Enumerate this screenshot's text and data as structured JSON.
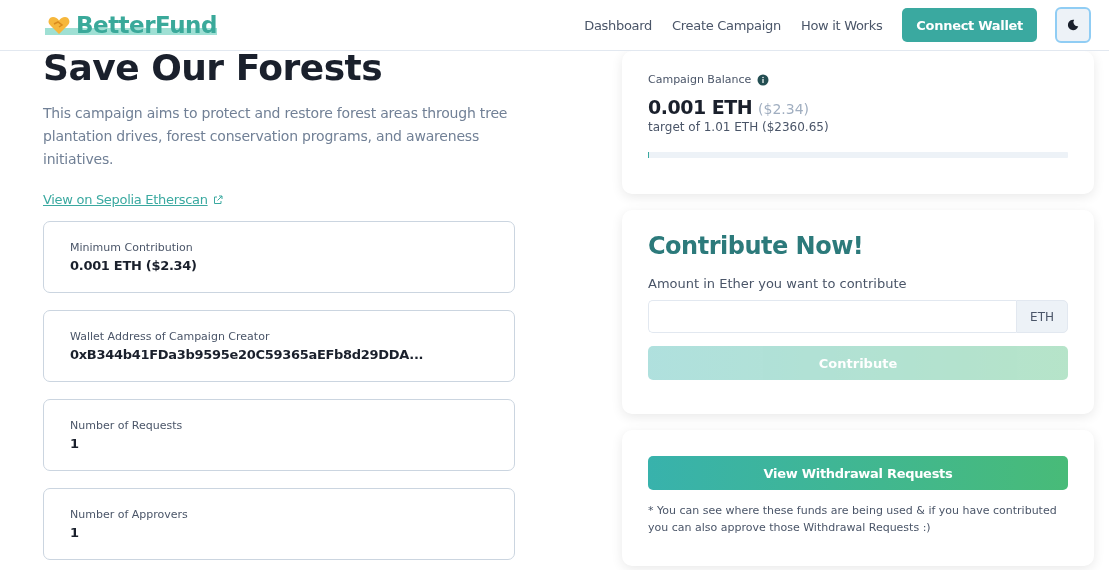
{
  "header": {
    "brand": "BetterFund",
    "nav": [
      "Dashboard",
      "Create Campaign",
      "How it Works"
    ],
    "connect_button": "Connect Wallet",
    "theme_toggle": {
      "dark": false
    }
  },
  "campaign": {
    "title": "Save Our Forests",
    "description": "This campaign aims to protect and restore forest areas through tree plantation drives, forest conservation programs, and awareness initiatives.",
    "etherscan_link": "View on Sepolia Etherscan",
    "stats": [
      {
        "label": "Minimum Contribution",
        "value": "0.001 ETH ($2.34)"
      },
      {
        "label": "Wallet Address of Campaign Creator",
        "value": "0xB344b41FDa3b9595e20C59365aEFb8d29DDA..."
      },
      {
        "label": "Number of Requests",
        "value": "1"
      },
      {
        "label": "Number of Approvers",
        "value": "1"
      }
    ]
  },
  "balance": {
    "label": "Campaign Balance",
    "amount": "0.001 ETH",
    "amount_usd": "($2.34)",
    "target": "target of 1.01 ETH ($2360.65)",
    "level": 0.002
  },
  "contribute": {
    "title": "Contribute Now!",
    "field_label": "Amount in Ether you want to contribute",
    "unit": "ETH",
    "button": "Contribute",
    "disabled": true
  },
  "withdrawal": {
    "button": "View Withdrawal Requests",
    "note": "* You can see where these funds are being used & if you have contributed you can also approve those Withdrawal Requests :)"
  }
}
